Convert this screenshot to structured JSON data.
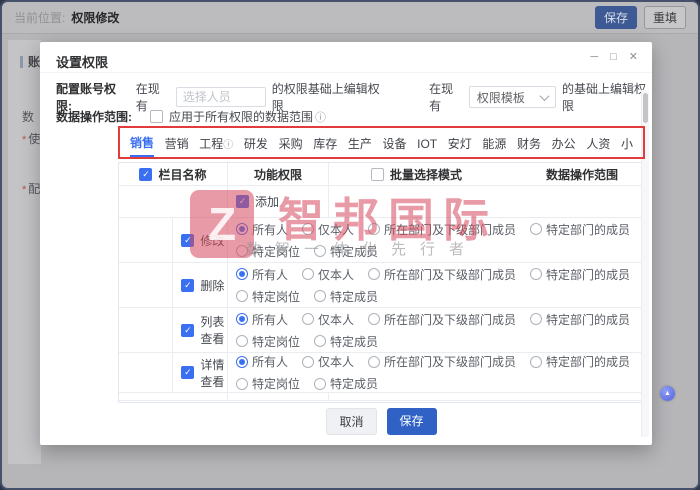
{
  "topbar": {
    "location_label": "当前位置:",
    "location_value": "权限修改",
    "save_label": "保存",
    "reset_label": "重填"
  },
  "background_page": {
    "section_title": "账号",
    "field_stubs": [
      {
        "required": false,
        "text": "数"
      },
      {
        "required": true,
        "text": "使"
      },
      {
        "required": true,
        "text": "配"
      }
    ],
    "required_glyph": "*"
  },
  "modal": {
    "title": "设置权限",
    "window_controls": {
      "minimize_glyph": "─",
      "maximize_glyph": "□",
      "close_glyph": "✕"
    },
    "config_row": {
      "label": "配置账号权限:",
      "prefix_existing": "在现有",
      "person_placeholder": "选择人员",
      "suffix_person": "的权限基础上编辑权限",
      "prefix_existing2": "在现有",
      "template_select_value": "权限模板",
      "suffix_template": "的基础上编辑权限"
    },
    "scope_row": {
      "label": "数据操作范围:",
      "checkbox_checked": false,
      "checkbox_label": "应用于所有权限的数据范围",
      "info_glyph": "ⓘ"
    },
    "tabs": [
      {
        "label": "销售",
        "active": true,
        "info": false
      },
      {
        "label": "营销",
        "active": false,
        "info": false
      },
      {
        "label": "工程",
        "active": false,
        "info": true
      },
      {
        "label": "研发",
        "active": false,
        "info": false
      },
      {
        "label": "采购",
        "active": false,
        "info": false
      },
      {
        "label": "库存",
        "active": false,
        "info": false
      },
      {
        "label": "生产",
        "active": false,
        "info": false
      },
      {
        "label": "设备",
        "active": false,
        "info": false
      },
      {
        "label": "IOT",
        "active": false,
        "info": false
      },
      {
        "label": "安灯",
        "active": false,
        "info": false
      },
      {
        "label": "能源",
        "active": false,
        "info": false
      },
      {
        "label": "财务",
        "active": false,
        "info": false
      },
      {
        "label": "办公",
        "active": false,
        "info": false
      },
      {
        "label": "人资",
        "active": false,
        "info": false
      },
      {
        "label": "小",
        "active": false,
        "info": false
      }
    ],
    "table": {
      "header": {
        "col_name": "栏目名称",
        "col_name_checked": true,
        "col_function": "功能权限",
        "batch_checkbox_label": "批量选择模式",
        "batch_checked": false,
        "col_scope": "数据操作范围"
      },
      "scope_line1": [
        "所有人",
        "仅本人",
        "所在部门及下级部门成员",
        "特定部门的成员"
      ],
      "scope_line2": [
        "特定岗位",
        "特定成员"
      ],
      "rows": [
        {
          "name": "添加",
          "checked": true,
          "has_options": false,
          "selected": ""
        },
        {
          "name": "修改",
          "checked": true,
          "has_options": true,
          "selected": "所有人"
        },
        {
          "name": "删除",
          "checked": true,
          "has_options": true,
          "selected": "所有人"
        },
        {
          "name": "列表查看",
          "checked": true,
          "has_options": true,
          "selected": "所有人"
        },
        {
          "name": "详情查看",
          "checked": true,
          "has_options": true,
          "selected": "所有人"
        }
      ]
    },
    "footer": {
      "cancel_label": "取消",
      "save_label": "保存"
    },
    "check_glyph": "✓"
  },
  "watermark": {
    "logo_letter": "Z",
    "brand": "智邦国际",
    "slogan": "数智一体化先行者"
  },
  "assistant_button": {
    "glyph": "▲"
  },
  "colors": {
    "accent_blue": "#3a6ff2",
    "footer_save_blue": "#2f62c4",
    "annotation_red": "#e23b3b",
    "watermark_red": "#d5495c",
    "overlay_gray": "#b6b6b9"
  }
}
